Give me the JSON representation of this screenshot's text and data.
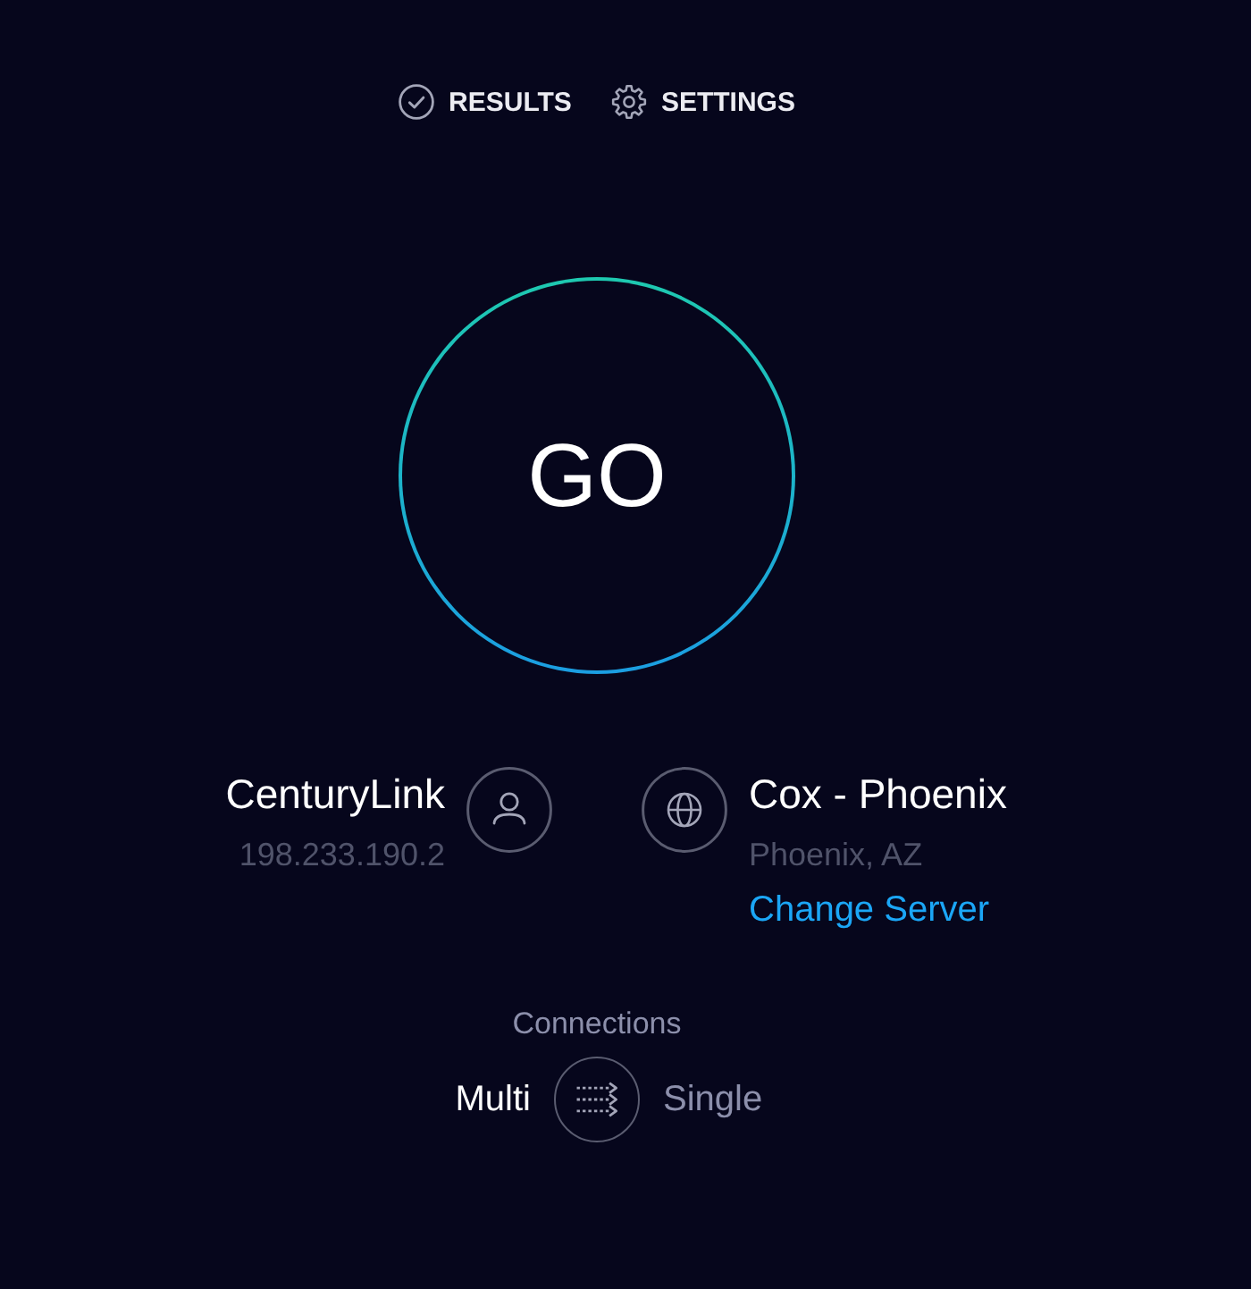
{
  "nav": {
    "tabs": [
      {
        "label": "RESULTS"
      },
      {
        "label": "SETTINGS"
      }
    ]
  },
  "start_button": {
    "label": "GO"
  },
  "isp": {
    "name": "CenturyLink",
    "ip": "198.233.190.2"
  },
  "server": {
    "name": "Cox - Phoenix",
    "location": "Phoenix, AZ",
    "link": "Change Server"
  },
  "connections": {
    "label": "Connections",
    "options": [
      {
        "label": "Multi",
        "selected": true
      },
      {
        "label": "Single",
        "selected": false
      }
    ]
  }
}
